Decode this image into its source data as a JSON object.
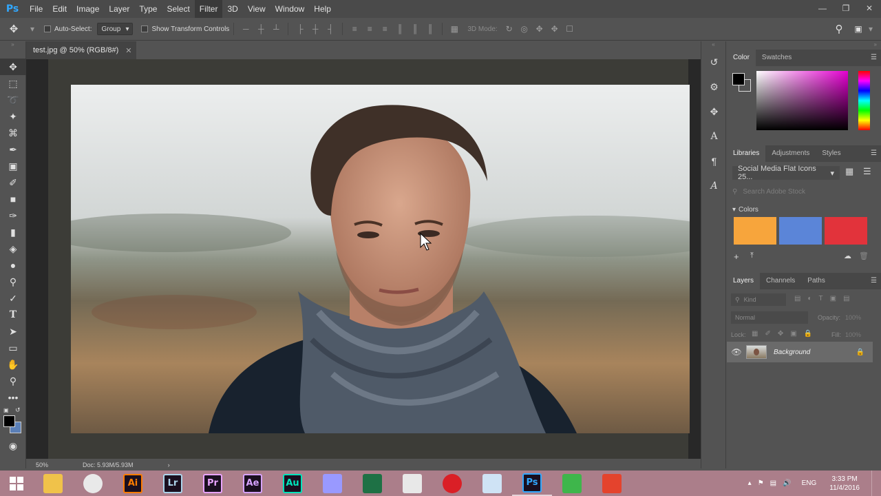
{
  "app": {
    "logo": "Ps"
  },
  "menu": [
    "File",
    "Edit",
    "Image",
    "Layer",
    "Type",
    "Select",
    "Filter",
    "3D",
    "View",
    "Window",
    "Help"
  ],
  "menu_active": "Filter",
  "options": {
    "auto_select_label": "Auto-Select:",
    "auto_select_value": "Group",
    "show_transform_label": "Show Transform Controls",
    "mode_3d_label": "3D Mode:"
  },
  "document": {
    "tab_title": "test.jpg @ 50% (RGB/8#)",
    "zoom": "50%",
    "doc_size": "Doc: 5.93M/5.93M"
  },
  "color_panel": {
    "tabs": [
      "Color",
      "Swatches"
    ],
    "foreground": "#000000",
    "background": "#ffffff",
    "hue": "#e400d0"
  },
  "libraries_panel": {
    "tabs": [
      "Libraries",
      "Adjustments",
      "Styles"
    ],
    "library_name": "Social Media Flat Icons 25...",
    "search_placeholder": "Search Adobe Stock",
    "colors_heading": "Colors",
    "swatches": [
      "#f7a53c",
      "#5b85d8",
      "#e2333b"
    ]
  },
  "layers_panel": {
    "tabs": [
      "Layers",
      "Channels",
      "Paths"
    ],
    "filter_label": "Kind",
    "blend_mode": "Normal",
    "opacity_label": "Opacity:",
    "opacity_value": "100%",
    "lock_label": "Lock:",
    "fill_label": "Fill:",
    "fill_value": "100%",
    "layers": [
      {
        "name": "Background",
        "visible": true,
        "locked": true
      }
    ]
  },
  "taskbar": {
    "apps": [
      {
        "name": "file-explorer",
        "label": "",
        "color": "#f0c24a"
      },
      {
        "name": "chrome",
        "label": "",
        "color": "#e9e9e9"
      },
      {
        "name": "illustrator",
        "label": "Ai",
        "color": "#ff7c00"
      },
      {
        "name": "lightroom",
        "label": "Lr",
        "color": "#add5ec"
      },
      {
        "name": "premiere",
        "label": "Pr",
        "color": "#e9a3ff"
      },
      {
        "name": "after-effects",
        "label": "Ae",
        "color": "#d7a2ff"
      },
      {
        "name": "audition",
        "label": "Au",
        "color": "#00e4bb"
      },
      {
        "name": "media-encoder",
        "label": "",
        "color": "#9999ff"
      },
      {
        "name": "excel",
        "label": "",
        "color": "#1e7145"
      },
      {
        "name": "paint",
        "label": "",
        "color": "#e8e8e8"
      },
      {
        "name": "creative-cloud",
        "label": "",
        "color": "#da1f26"
      },
      {
        "name": "screenshot-app",
        "label": "",
        "color": "#cfe3f5"
      },
      {
        "name": "photoshop",
        "label": "Ps",
        "color": "#31a8ff"
      },
      {
        "name": "camtasia-green",
        "label": "",
        "color": "#3eb64b"
      },
      {
        "name": "camtasia-orange",
        "label": "",
        "color": "#e4432d"
      }
    ],
    "language": "ENG",
    "time": "3:33 PM",
    "date": "11/4/2016"
  }
}
